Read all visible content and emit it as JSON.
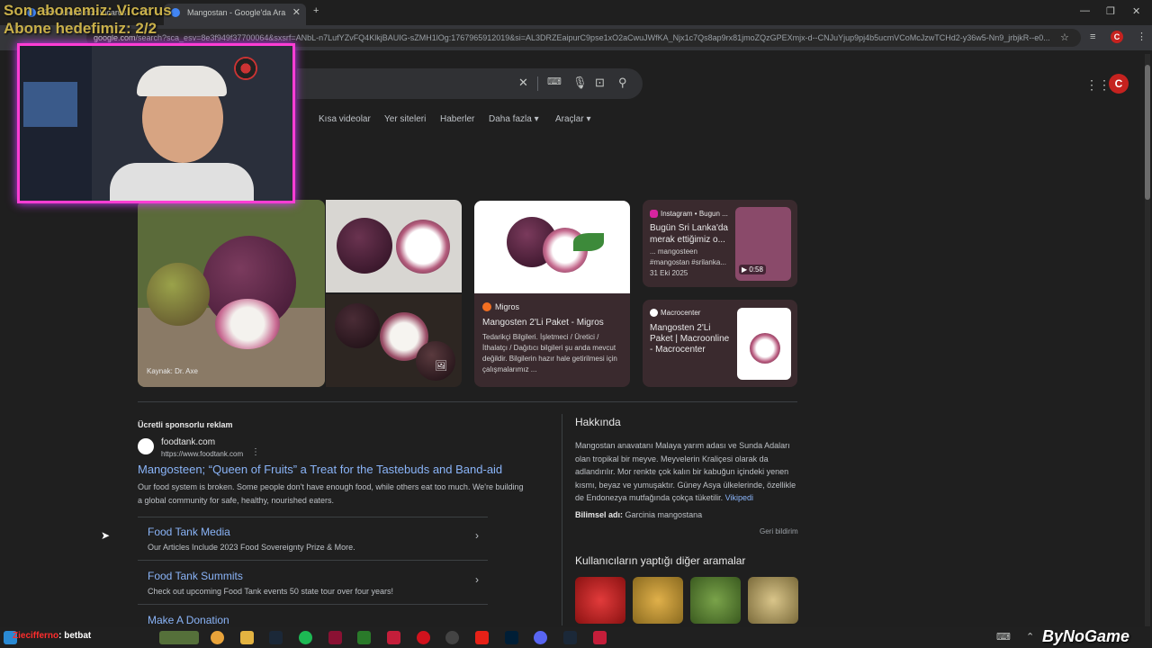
{
  "browser": {
    "tabs": [
      {
        "label": "Son abonemiz: Vicarus",
        "active": false
      },
      {
        "label": "Mangostan - Google'da Ara",
        "active": true
      }
    ],
    "url_domain": "google.com",
    "url_rest": "/search?sca_esv=8e3f949f37700064&sxsrf=ANbL-n7LufYZvFQ4KlkjBAUIG-sZMH1lOg:1767965912019&si=AL3DRZEaipurC9pse1xO2aCwuJWfKA_Njx1c7Qs8ap9rx81jmoZQzGPEXmjx-d--CNJuYjup9pj4b5ucmVCoMcJzwTCHd2-y36w5-Nn9_jrbjkR--e0...",
    "profile_initial": "C"
  },
  "search": {
    "nav_tabs": [
      "Kısa videolar",
      "Yer siteleri",
      "Haberler",
      "Daha fazla",
      "Araçlar"
    ]
  },
  "images": {
    "main_source": "Kaynak: Dr. Axe",
    "migros": {
      "source": "Migros",
      "title": "Mangosten 2'Li Paket - Migros",
      "desc": "Tedarikçi Bilgileri. İşletmeci / Üretici / İthalatçı / Dağıtıcı bilgileri şu anda mevcut değildir. Bilgilerin hazır hale getirilmesi için çalışmalarımız ..."
    },
    "instagram": {
      "source": "Instagram • Bugun ...",
      "title": "Bugün Sri Lanka'da merak ettiğimiz o...",
      "desc": "... mangosteen #mangostan #srilanka...",
      "date": "31 Eki 2025",
      "duration": "0:58"
    },
    "macrocenter": {
      "source": "Macrocenter",
      "title": "Mangosten 2'Li Paket | Macroonline - Macrocenter"
    }
  },
  "ad": {
    "label": "Ücretli sponsorlu reklam",
    "site_name": "foodtank.com",
    "site_url": "https://www.foodtank.com",
    "title": "Mangosteen; “Queen of Fruits” a Treat for the Tastebuds and Band-aid",
    "desc": "Our food system is broken. Some people don't have enough food, while others eat too much. We're building a global community for safe, healthy, nourished eaters.",
    "sitelinks": [
      {
        "title": "Food Tank Media",
        "desc": "Our Articles Include 2023 Food Sovereignty Prize & More."
      },
      {
        "title": "Food Tank Summits",
        "desc": "Check out upcoming Food Tank events 50 state tour over four years!"
      },
      {
        "title": "Make A Donation",
        "desc": ""
      }
    ]
  },
  "knowledge": {
    "heading": "Hakkında",
    "desc": "Mangostan anavatanı Malaya yarım adası ve Sunda Adaları olan tropikal bir meyve. Meyvelerin Kraliçesi olarak da adlandırılır. Mor renkte çok kalın bir kabuğun içindeki yenen kısmı, beyaz ve yumuşaktır. Güney Asya ülkelerinde, özellikle de Endonezya mutfağında çokça tüketilir.",
    "wiki_link": "Vikipedi",
    "sci_label": "Bilimsel adı:",
    "sci_value": "Garcinia mangostana",
    "feedback": "Geri bildirim",
    "related_heading": "Kullanıcıların yaptığı diğer aramalar"
  },
  "overlay": {
    "line1": "Son abonemiz: Vicarus",
    "line2": "Abone hedefimiz: 2/2",
    "chat_user": "Ziecifferno",
    "chat_msg": ": betbat",
    "brand": "ByNoGame"
  },
  "colors": {
    "accent_link": "#8ab4f8",
    "webcam_border": "#ff3dd4",
    "overlay_text": "#c9b04a"
  }
}
